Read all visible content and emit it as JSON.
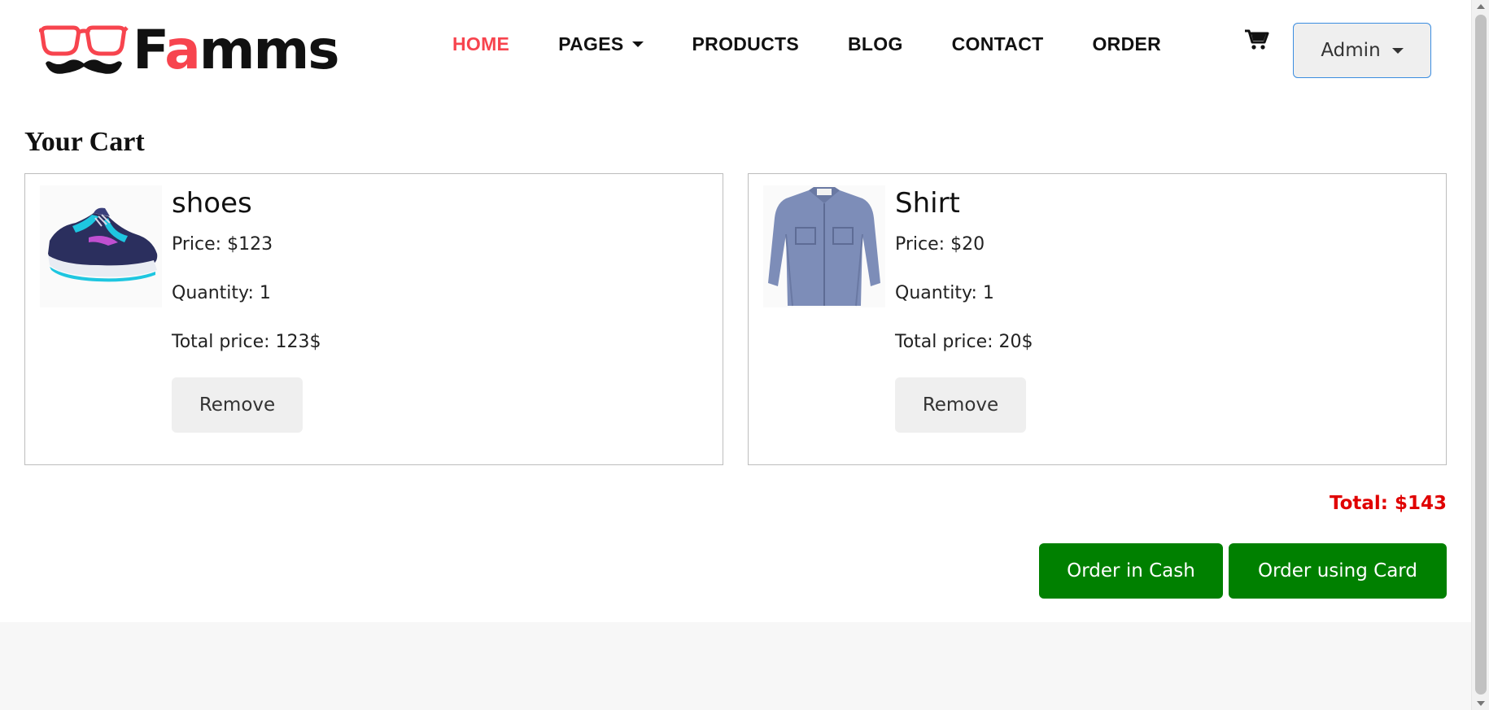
{
  "brand": {
    "text_before": "F",
    "text_accent": "a",
    "text_after": "mms",
    "accent_color": "#f7444e"
  },
  "nav": {
    "items": [
      {
        "label": "HOME",
        "active": true
      },
      {
        "label": "PAGES",
        "active": false
      },
      {
        "label": "PRODUCTS",
        "active": false
      },
      {
        "label": "BLOG",
        "active": false
      },
      {
        "label": "CONTACT",
        "active": false
      },
      {
        "label": "ORDER",
        "active": false
      }
    ],
    "cart_icon": "shopping-cart-icon",
    "user_menu_label": "Admin"
  },
  "cart": {
    "title": "Your Cart",
    "items": [
      {
        "name": "shoes",
        "price": "Price: $123",
        "quantity": "Quantity: 1",
        "total": "Total price: 123$",
        "remove_label": "Remove",
        "image": "running-shoe-image"
      },
      {
        "name": "Shirt",
        "price": "Price: $20",
        "quantity": "Quantity: 1",
        "total": "Total price: 20$",
        "remove_label": "Remove",
        "image": "denim-shirt-image"
      }
    ],
    "grand_total": "Total: $143",
    "order_cash_label": "Order in Cash",
    "order_card_label": "Order using Card"
  },
  "colors": {
    "accent": "#f7444e",
    "order_button": "#008000",
    "total_text": "#e00000"
  }
}
